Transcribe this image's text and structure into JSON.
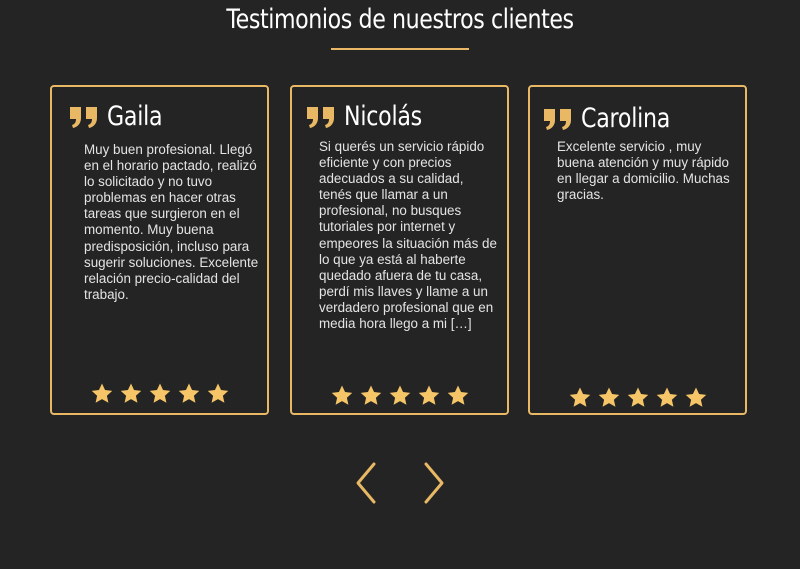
{
  "section": {
    "title": "Testimonios de nuestros clientes"
  },
  "colors": {
    "accent": "#e9b865",
    "background": "#242424",
    "text": "#e4e4e4"
  },
  "testimonials": [
    {
      "name": "Gaila",
      "text": "Muy buen profesional. Llegó en el horario pactado, realizó lo solicitado y no tuvo problemas en hacer otras tareas que surgieron en el momento. Muy buena predisposición, incluso para sugerir soluciones. Excelente relación precio-calidad del trabajo.",
      "rating": 5
    },
    {
      "name": "Nicolás",
      "text": "Si querés un servicio rápido eficiente y con precios adecuados a su calidad, tenés que llamar a un profesional, no busques tutoriales por internet y empeores la situación más de lo que ya está al haberte quedado afuera de tu casa, perdí mis llaves y llame a un verdadero profesional que en media hora llego a mi […]",
      "rating": 5
    },
    {
      "name": "Carolina",
      "text": "Excelente servicio , muy buena atención y muy rápido en llegar a domicilio. Muchas gracias.",
      "rating": 5
    }
  ],
  "icons": {
    "quote": "quote-icon",
    "star": "star-icon",
    "prev": "chevron-left-icon",
    "next": "chevron-right-icon"
  }
}
